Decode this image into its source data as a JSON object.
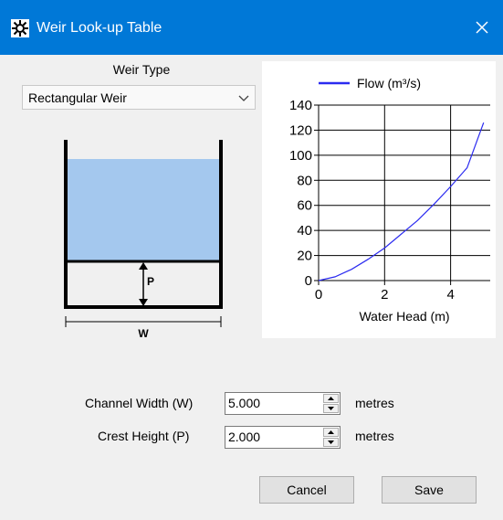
{
  "window": {
    "title": "Weir Look-up Table",
    "icons": {
      "app": "gear-icon",
      "close": "close-icon"
    },
    "accent_color": "#0078d7"
  },
  "weir_type": {
    "label": "Weir Type",
    "selected": "Rectangular Weir",
    "icon": "chevron-down-icon"
  },
  "diagram": {
    "p_label": "P",
    "w_label": "W",
    "water_color": "#a4c8ee"
  },
  "chart_data": {
    "type": "line",
    "xlabel": "Water Head (m)",
    "ylabel": "",
    "xlim": [
      0,
      5.2
    ],
    "ylim": [
      0,
      140
    ],
    "xticks": [
      0,
      2,
      4
    ],
    "yticks": [
      0,
      20,
      40,
      60,
      80,
      100,
      120,
      140
    ],
    "grid": true,
    "legend_position": "top",
    "series": [
      {
        "name": "Flow (m³/s)",
        "color": "#2b2bf0",
        "x": [
          0,
          0.5,
          1,
          1.5,
          2,
          2.5,
          3,
          3.5,
          4,
          4.5,
          5
        ],
        "y": [
          0,
          3,
          9,
          17,
          26,
          37,
          48,
          61,
          75,
          90,
          126
        ]
      }
    ]
  },
  "fields": {
    "channel_width": {
      "label": "Channel Width (W)",
      "value": "5.000",
      "unit": "metres"
    },
    "crest_height": {
      "label": "Crest Height (P)",
      "value": "2.000",
      "unit": "metres"
    }
  },
  "buttons": {
    "cancel": "Cancel",
    "save": "Save"
  }
}
